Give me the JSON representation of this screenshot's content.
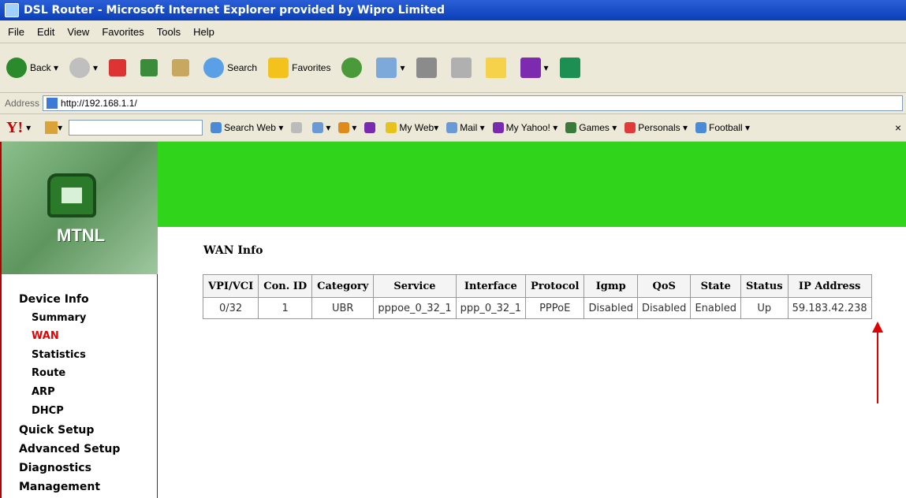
{
  "window": {
    "title": "DSL Router - Microsoft Internet Explorer provided by Wipro Limited"
  },
  "menu": [
    "File",
    "Edit",
    "View",
    "Favorites",
    "Tools",
    "Help"
  ],
  "toolbar": {
    "back": "Back",
    "search": "Search",
    "favorites": "Favorites"
  },
  "address": {
    "label": "Address",
    "url": "http://192.168.1.1/"
  },
  "yahoo_bar": {
    "search_button": "Search Web",
    "my_web": "My Web",
    "mail": "Mail",
    "my_yahoo": "My Yahoo!",
    "games": "Games",
    "personals": "Personals",
    "football": "Football"
  },
  "brand": {
    "logo_text": "MTNL"
  },
  "sidebar": {
    "device_info": "Device Info",
    "items": [
      "Summary",
      "WAN",
      "Statistics",
      "Route",
      "ARP",
      "DHCP"
    ],
    "active": "WAN",
    "quick_setup": "Quick Setup",
    "advanced_setup": "Advanced Setup",
    "diagnostics": "Diagnostics",
    "management": "Management"
  },
  "page": {
    "title": "WAN Info"
  },
  "table": {
    "headers": [
      "VPI/VCI",
      "Con. ID",
      "Category",
      "Service",
      "Interface",
      "Protocol",
      "Igmp",
      "QoS",
      "State",
      "Status",
      "IP Address"
    ],
    "rows": [
      [
        "0/32",
        "1",
        "UBR",
        "pppoe_0_32_1",
        "ppp_0_32_1",
        "PPPoE",
        "Disabled",
        "Disabled",
        "Enabled",
        "Up",
        "59.183.42.238"
      ]
    ]
  },
  "colors": {
    "accent_red": "#e00000",
    "header_green": "#2fd41b"
  }
}
